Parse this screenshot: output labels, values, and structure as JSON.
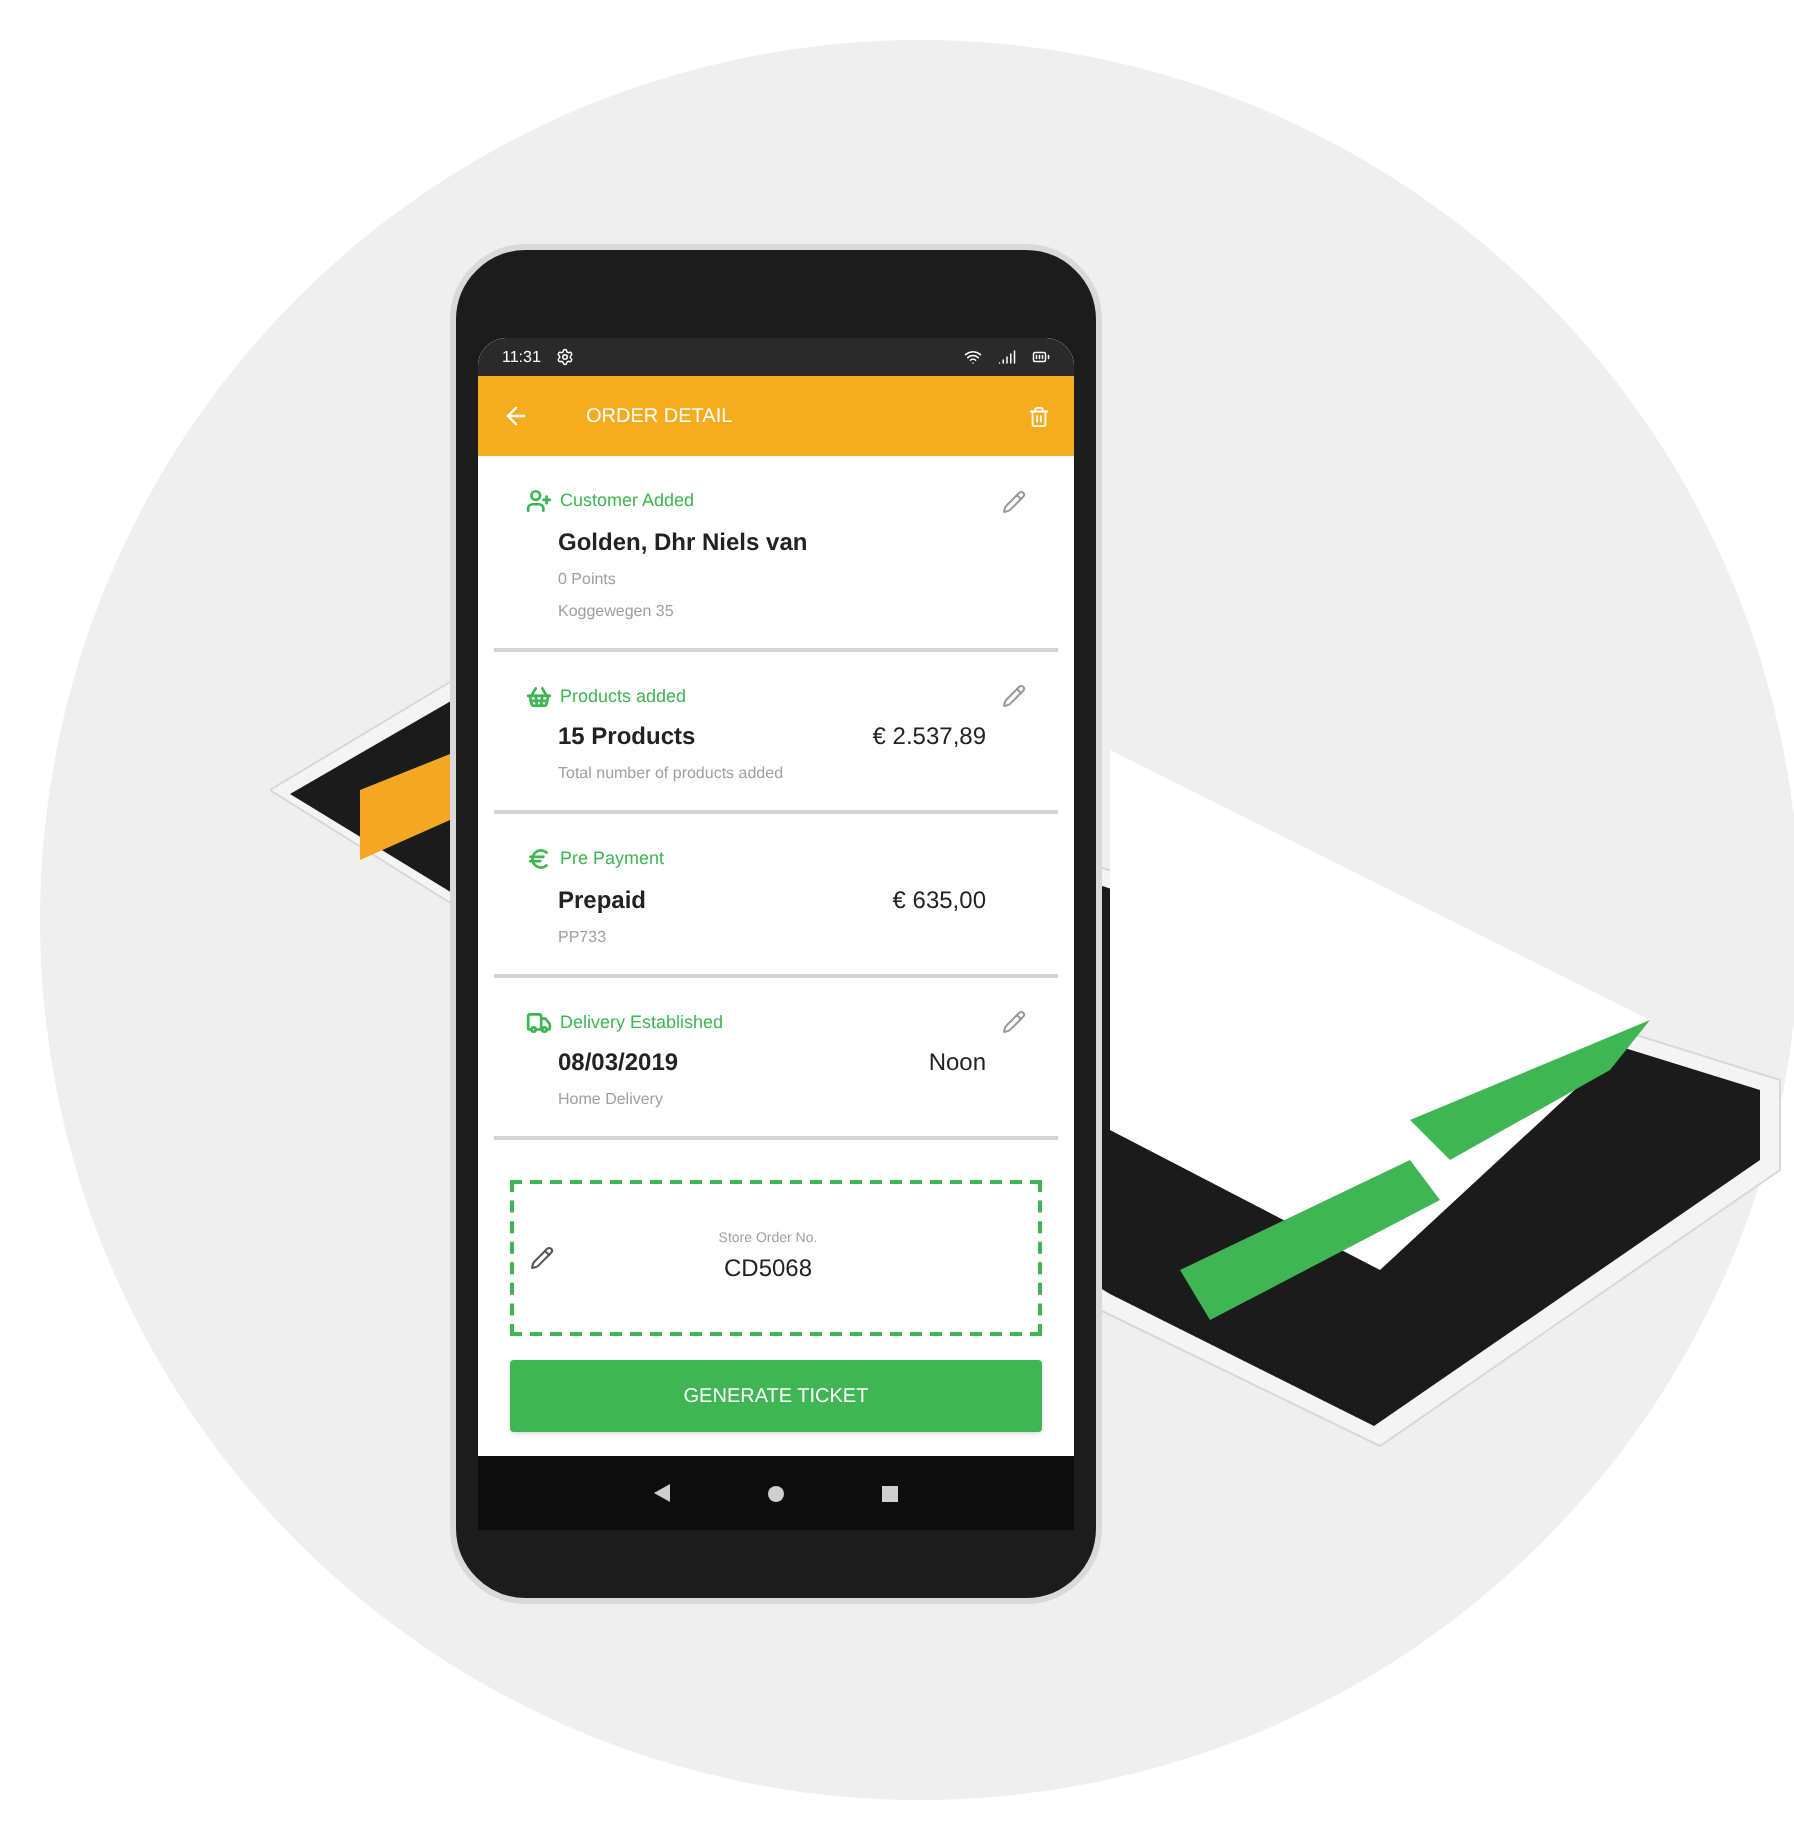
{
  "status_bar": {
    "time": "11:31"
  },
  "app_bar": {
    "title": "ORDER DETAIL"
  },
  "sections": [
    {
      "kind": "customer",
      "label": "Customer Added",
      "title": "Golden, Dhr Niels van",
      "lines": [
        "0 Points",
        "Koggewegen 35"
      ],
      "editable": true
    },
    {
      "kind": "products",
      "label": "Products added",
      "title": "15 Products",
      "value": "€ 2.537,89",
      "lines": [
        "Total number of products added"
      ],
      "editable": true
    },
    {
      "kind": "payment",
      "label": "Pre Payment",
      "title": "Prepaid",
      "value": "€ 635,00",
      "lines": [
        "PP733"
      ],
      "editable": false
    },
    {
      "kind": "delivery",
      "label": "Delivery Established",
      "title": "08/03/2019",
      "value": "Noon",
      "lines": [
        "Home Delivery"
      ],
      "editable": true
    }
  ],
  "store_order": {
    "label": "Store Order No.",
    "value": "CD5068"
  },
  "primary_button": "GENERATE TICKET"
}
